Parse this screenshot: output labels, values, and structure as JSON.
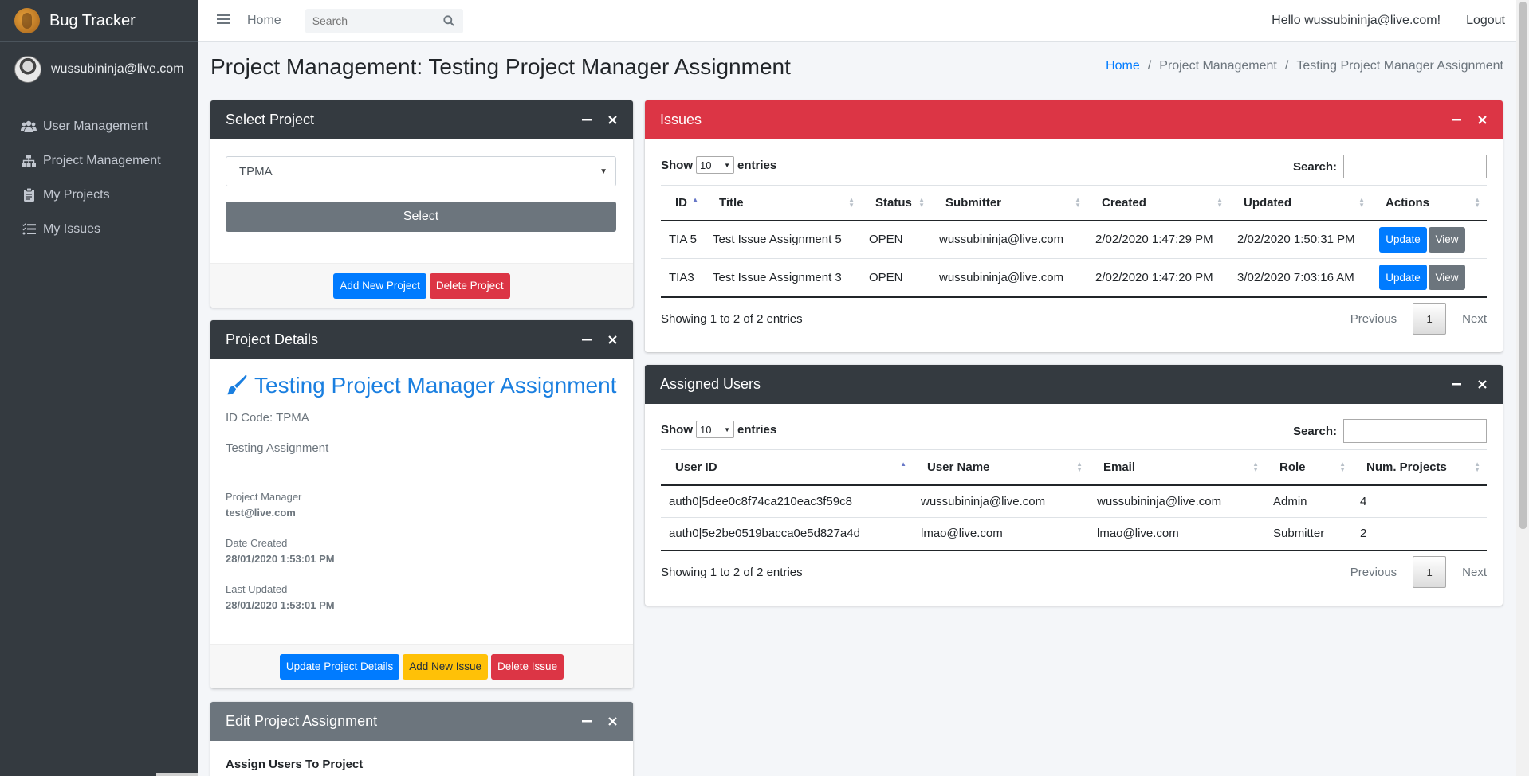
{
  "brand": {
    "name": "Bug Tracker"
  },
  "sidebar": {
    "user": "wussubininja@live.com",
    "items": [
      {
        "label": "User Management",
        "icon": "users-icon"
      },
      {
        "label": "Project Management",
        "icon": "sitemap-icon"
      },
      {
        "label": "My Projects",
        "icon": "clipboard-icon"
      },
      {
        "label": "My Issues",
        "icon": "tasks-icon"
      }
    ]
  },
  "topbar": {
    "home": "Home",
    "search_placeholder": "Search",
    "greeting": "Hello wussubininja@live.com!",
    "logout": "Logout"
  },
  "page": {
    "title": "Project Management: Testing Project Manager Assignment",
    "breadcrumb": [
      "Home",
      "Project Management",
      "Testing Project Manager Assignment"
    ]
  },
  "select_project": {
    "title": "Select Project",
    "selected": "TPMA",
    "select_label": "Select",
    "add_label": "Add New Project",
    "delete_label": "Delete Project"
  },
  "project_details": {
    "title": "Project Details",
    "name": "Testing Project Manager Assignment",
    "id_code": "ID Code: TPMA",
    "description": "Testing Assignment",
    "manager_label": "Project Manager",
    "manager": "test@live.com",
    "created_label": "Date Created",
    "created": "28/01/2020 1:53:01 PM",
    "updated_label": "Last Updated",
    "updated": "28/01/2020 1:53:01 PM",
    "update_label": "Update Project Details",
    "add_issue_label": "Add New Issue",
    "delete_issue_label": "Delete Issue"
  },
  "edit_assignment": {
    "title": "Edit Project Assignment",
    "subtitle": "Assign Users To Project"
  },
  "issues": {
    "title": "Issues",
    "show": "Show",
    "entries_count": "10",
    "entries": "entries",
    "search_label": "Search:",
    "columns": [
      "ID",
      "Title",
      "Status",
      "Submitter",
      "Created",
      "Updated",
      "Actions"
    ],
    "rows": [
      {
        "id": "TIA 5",
        "title": "Test Issue Assignment 5",
        "status": "OPEN",
        "submitter": "wussubininja@live.com",
        "created": "2/02/2020 1:47:29 PM",
        "updated": "2/02/2020 1:50:31 PM"
      },
      {
        "id": "TIA3",
        "title": "Test Issue Assignment 3",
        "status": "OPEN",
        "submitter": "wussubininja@live.com",
        "created": "2/02/2020 1:47:20 PM",
        "updated": "3/02/2020 7:03:16 AM"
      }
    ],
    "update_label": "Update",
    "view_label": "View",
    "info": "Showing 1 to 2 of 2 entries",
    "previous": "Previous",
    "page": "1",
    "next": "Next"
  },
  "assigned_users": {
    "title": "Assigned Users",
    "show": "Show",
    "entries_count": "10",
    "entries": "entries",
    "search_label": "Search:",
    "columns": [
      "User ID",
      "User Name",
      "Email",
      "Role",
      "Num. Projects"
    ],
    "rows": [
      {
        "user_id": "auth0|5dee0c8f74ca210eac3f59c8",
        "user_name": "wussubininja@live.com",
        "email": "wussubininja@live.com",
        "role": "Admin",
        "num_projects": "4"
      },
      {
        "user_id": "auth0|5e2be0519bacca0e5d827a4d",
        "user_name": "lmao@live.com",
        "email": "lmao@live.com",
        "role": "Submitter",
        "num_projects": "2"
      }
    ],
    "info": "Showing 1 to 2 of 2 entries",
    "previous": "Previous",
    "page": "1",
    "next": "Next"
  }
}
